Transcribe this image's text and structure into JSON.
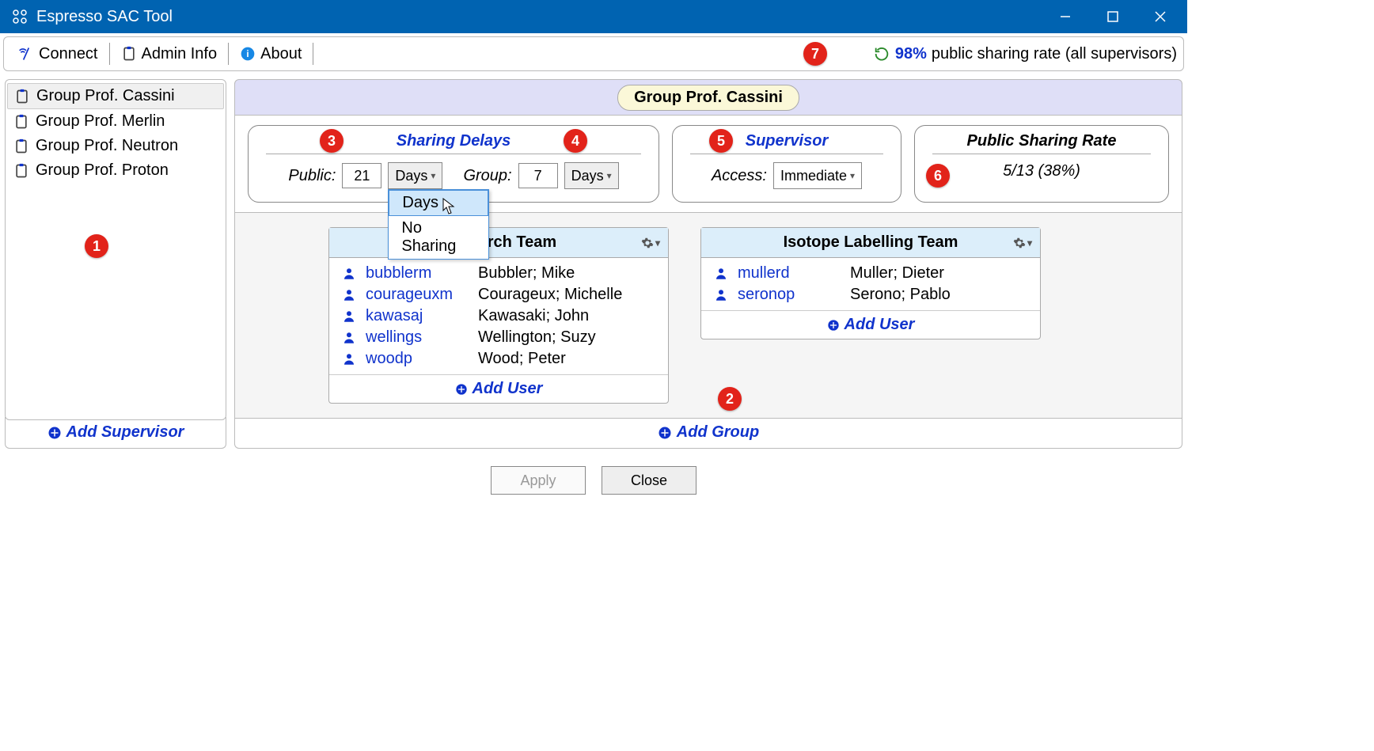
{
  "titlebar": {
    "title": "Espresso SAC Tool"
  },
  "toolbar": {
    "connect": "Connect",
    "admin": "Admin Info",
    "about": "About",
    "global_rate_pct": "98%",
    "global_rate_text": "public sharing rate (all supervisors)"
  },
  "sidebar": {
    "items": [
      "Group Prof. Cassini",
      "Group Prof. Merlin",
      "Group Prof. Neutron",
      "Group Prof. Proton"
    ],
    "selected": 0,
    "add_label": "Add Supervisor"
  },
  "group": {
    "title": "Group Prof. Cassini",
    "delays_panel_title": "Sharing Delays",
    "public_label": "Public:",
    "public_value": "21",
    "public_unit": "Days",
    "group_label": "Group:",
    "group_value": "7",
    "group_unit": "Days",
    "unit_options": [
      "Days",
      "No Sharing"
    ],
    "supervisor_panel_title": "Supervisor",
    "supervisor_access_label": "Access:",
    "supervisor_access_value": "Immediate",
    "rate_panel_title": "Public Sharing Rate",
    "rate_value": "5/13 (38%)"
  },
  "teams": [
    {
      "name": "Research Team",
      "users": [
        {
          "id": "bubblerm",
          "name": "Bubbler; Mike"
        },
        {
          "id": "courageuxm",
          "name": "Courageux; Michelle"
        },
        {
          "id": "kawasaj",
          "name": "Kawasaki; John"
        },
        {
          "id": "wellings",
          "name": "Wellington; Suzy"
        },
        {
          "id": "woodp",
          "name": "Wood; Peter"
        }
      ]
    },
    {
      "name": "Isotope Labelling Team",
      "users": [
        {
          "id": "mullerd",
          "name": "Muller; Dieter"
        },
        {
          "id": "seronop",
          "name": "Serono; Pablo"
        }
      ]
    }
  ],
  "add_user_label": "Add User",
  "add_group_label": "Add Group",
  "footer": {
    "apply": "Apply",
    "close": "Close"
  },
  "annotations": [
    "1",
    "2",
    "3",
    "4",
    "5",
    "6",
    "7"
  ]
}
